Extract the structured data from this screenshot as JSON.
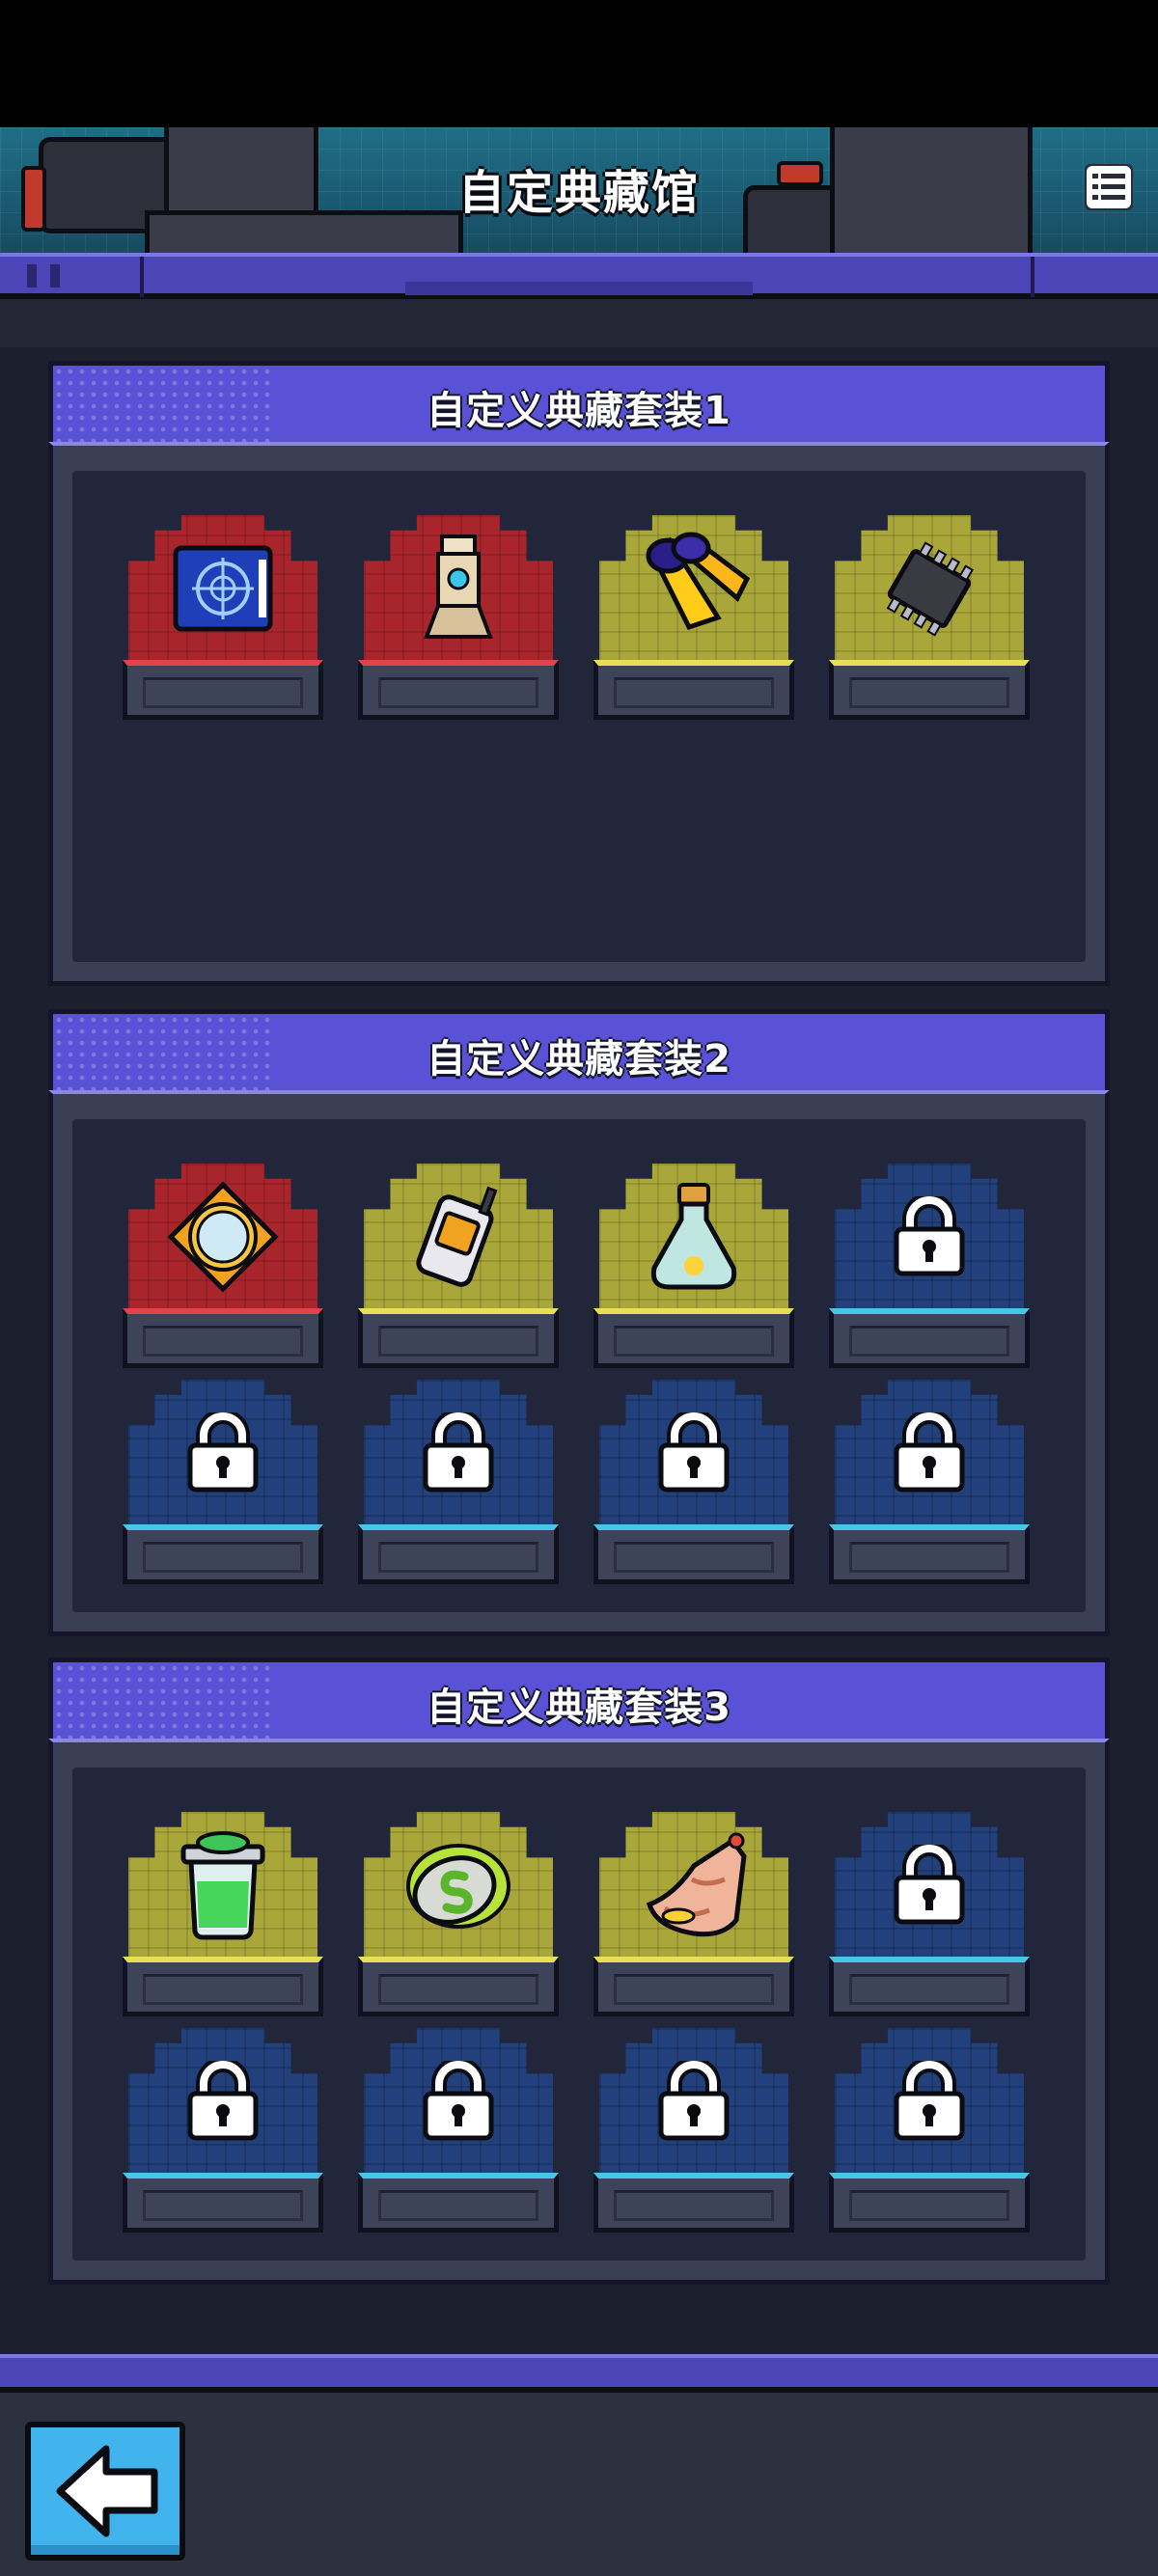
{
  "header": {
    "title": "自定典藏馆",
    "menu_icon": "list-menu-icon"
  },
  "sections": [
    {
      "title": "自定义典藏套装1",
      "slots": [
        {
          "state": "item",
          "rarity": "red",
          "icon": "blueprint-icon"
        },
        {
          "state": "item",
          "rarity": "red",
          "icon": "robot-statue-icon"
        },
        {
          "state": "item",
          "rarity": "yellow",
          "icon": "swim-fins-icon"
        },
        {
          "state": "item",
          "rarity": "yellow",
          "icon": "microchip-icon"
        }
      ]
    },
    {
      "title": "自定义典藏套装2",
      "slots": [
        {
          "state": "item",
          "rarity": "red",
          "icon": "golden-mirror-icon"
        },
        {
          "state": "item",
          "rarity": "yellow",
          "icon": "walkie-talkie-icon"
        },
        {
          "state": "item",
          "rarity": "yellow",
          "icon": "firefly-jar-icon"
        },
        {
          "state": "locked",
          "rarity": "blue",
          "icon": "lock-icon"
        },
        {
          "state": "locked",
          "rarity": "blue",
          "icon": "lock-icon"
        },
        {
          "state": "locked",
          "rarity": "blue",
          "icon": "lock-icon"
        },
        {
          "state": "locked",
          "rarity": "blue",
          "icon": "lock-icon"
        },
        {
          "state": "locked",
          "rarity": "blue",
          "icon": "lock-icon"
        }
      ]
    },
    {
      "title": "自定义典藏套装3",
      "slots": [
        {
          "state": "item",
          "rarity": "yellow",
          "icon": "green-slime-jar-icon"
        },
        {
          "state": "item",
          "rarity": "yellow",
          "icon": "slime-soap-icon"
        },
        {
          "state": "item",
          "rarity": "yellow",
          "icon": "conch-shell-icon"
        },
        {
          "state": "locked",
          "rarity": "blue",
          "icon": "lock-icon"
        },
        {
          "state": "locked",
          "rarity": "blue",
          "icon": "lock-icon"
        },
        {
          "state": "locked",
          "rarity": "blue",
          "icon": "lock-icon"
        },
        {
          "state": "locked",
          "rarity": "blue",
          "icon": "lock-icon"
        },
        {
          "state": "locked",
          "rarity": "blue",
          "icon": "lock-icon"
        }
      ]
    }
  ],
  "footer": {
    "back_icon": "back-arrow-icon"
  },
  "colors": {
    "accent": "#5a52d6",
    "rarity_red": "#a8252b",
    "rarity_yellow": "#aaa73a",
    "rarity_blue": "#22407c",
    "back_button": "#41b4ee"
  }
}
